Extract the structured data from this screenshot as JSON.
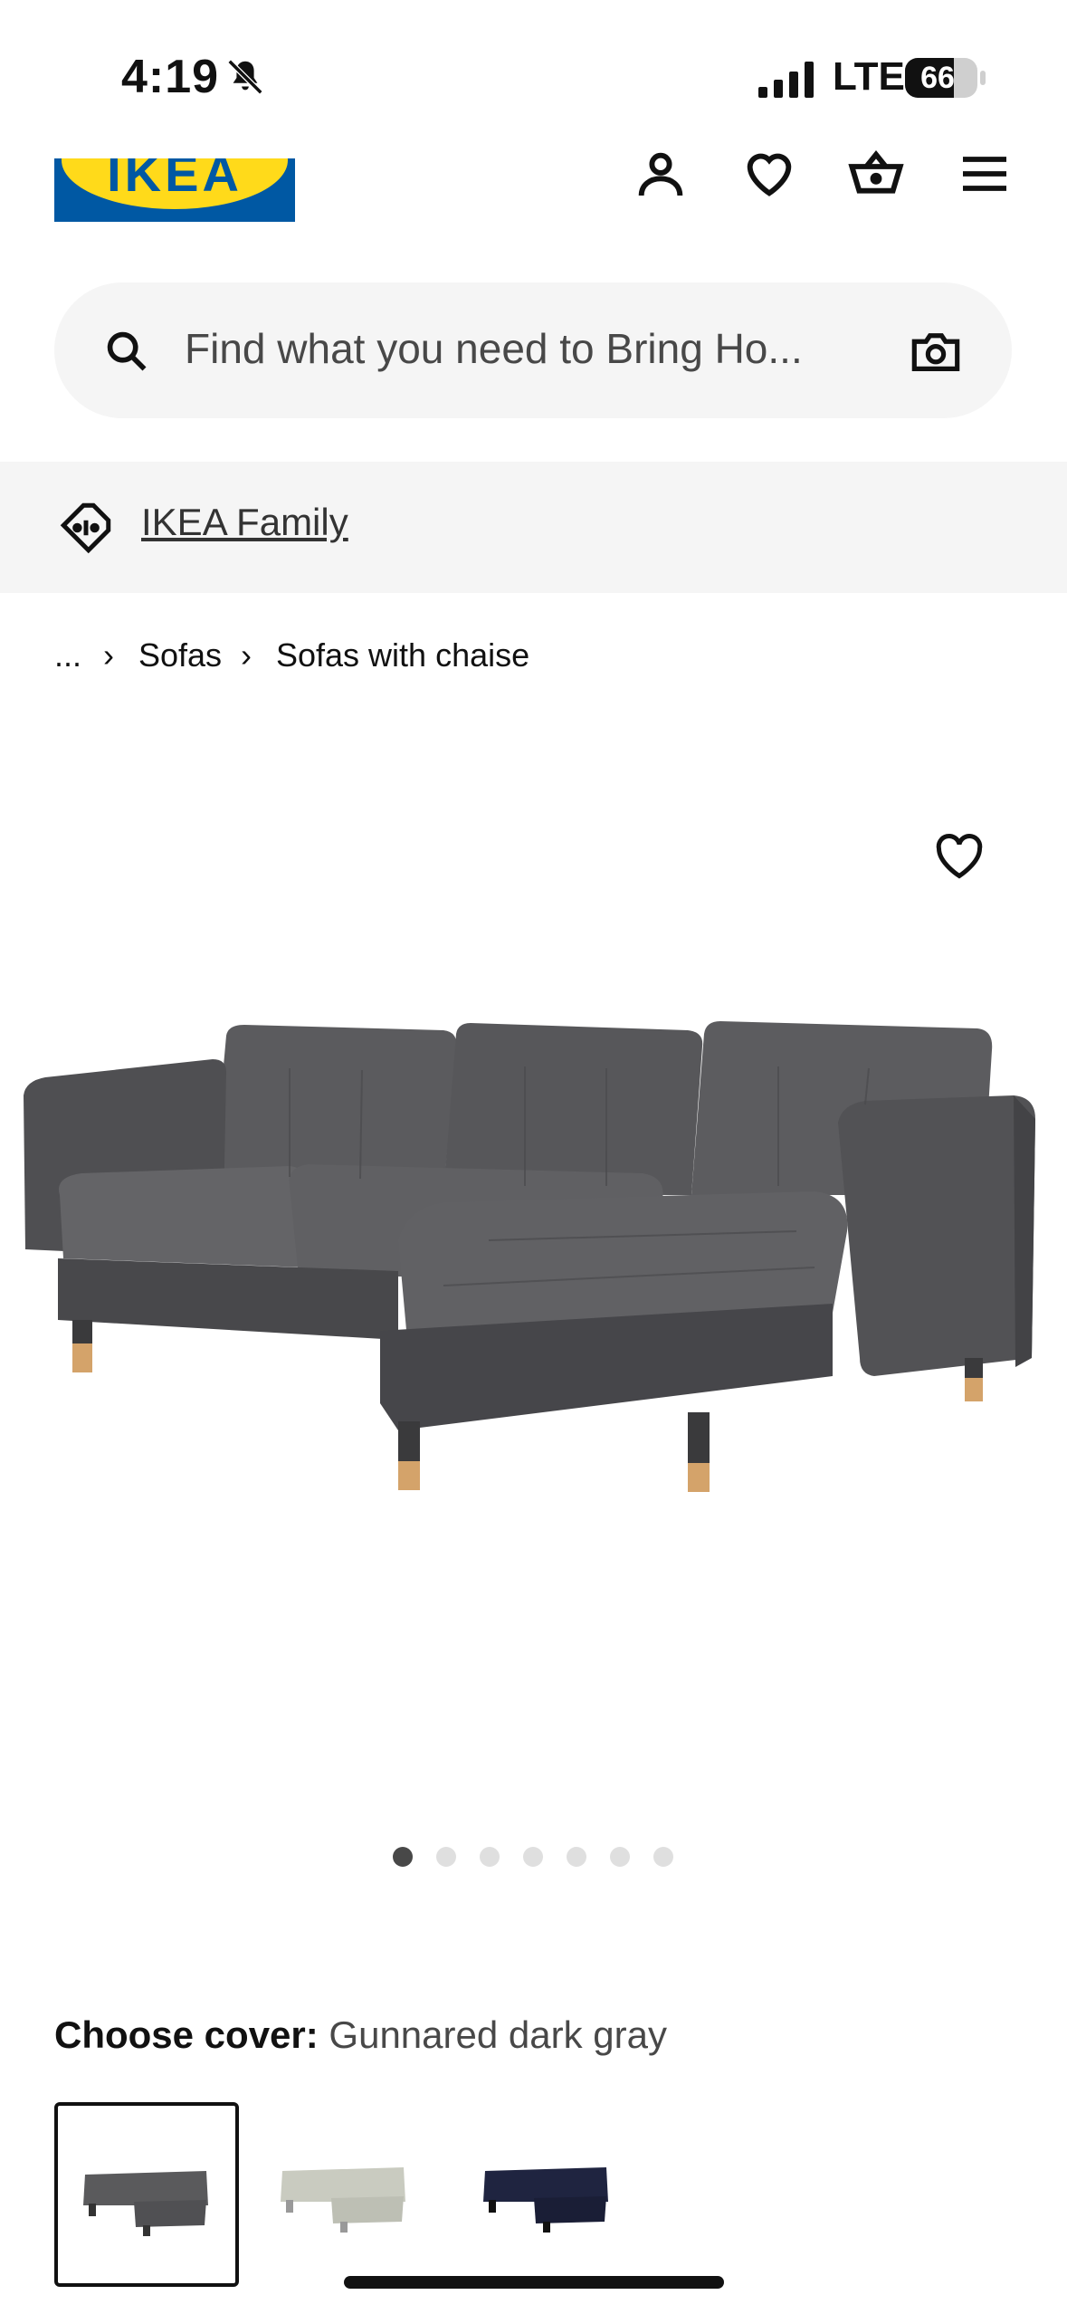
{
  "status_bar": {
    "time": "4:19",
    "network": "LTE",
    "battery": "66"
  },
  "header": {
    "logo_text": "IKEA",
    "icons": [
      "profile-icon",
      "heart-icon",
      "cart-icon",
      "menu-icon"
    ]
  },
  "search": {
    "placeholder": "Find what you need to Bring Ho..."
  },
  "family": {
    "label": "IKEA Family"
  },
  "breadcrumb": {
    "ellipsis": "...",
    "items": [
      "Sofas",
      "Sofas with chaise"
    ]
  },
  "gallery": {
    "image_count": 7,
    "active_index": 0
  },
  "cover": {
    "label": "Choose cover:",
    "selected": "Gunnared dark gray",
    "options": [
      {
        "color": "#5a5a5c",
        "selected": true
      },
      {
        "color": "#c9cbc0",
        "selected": false
      },
      {
        "color": "#1f2440",
        "selected": false
      }
    ]
  },
  "colors": {
    "ikea_blue": "#0058a3",
    "ikea_yellow": "#ffda1a",
    "sofa_gray": "#5a5a5c"
  }
}
